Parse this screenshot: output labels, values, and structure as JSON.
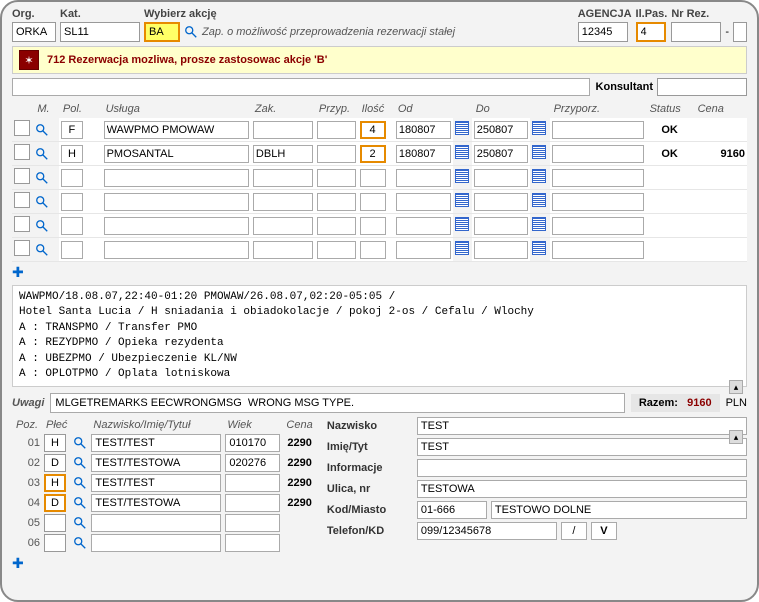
{
  "top": {
    "org_label": "Org.",
    "org": "ORKA",
    "kat_label": "Kat.",
    "kat": "SL11",
    "akcja_label": "Wybierz akcję",
    "akcja": "BA",
    "akcja_desc": "Zap. o możliwość przeprowadzenia rezerwacji stałej",
    "agencja_label": "AGENCJA",
    "agencja": "12345",
    "ilpas_label": "Il.Pas.",
    "ilpas": "4",
    "nrrez_label": "Nr Rez.",
    "nrrez": "",
    "nrrez2": ""
  },
  "message": "712 Rezerwacja mozliwa, prosze zastosowac akcje 'B'",
  "konsultant_label": "Konsultant",
  "grid_headers": {
    "m": "M.",
    "pol": "Pol.",
    "usluga": "Usługa",
    "zak": "Zak.",
    "przyp": "Przyp.",
    "ilosc": "Ilość",
    "od": "Od",
    "do": "Do",
    "przyporz": "Przyporz.",
    "status": "Status",
    "cena": "Cena"
  },
  "rows": [
    {
      "pol": "F",
      "usluga": "WAWPMO PMOWAW",
      "zak": "",
      "ilosc": "4",
      "od": "180807",
      "do": "250807",
      "status": "OK",
      "cena": ""
    },
    {
      "pol": "H",
      "usluga": "PMOSANTAL",
      "zak": "DBLH",
      "ilosc": "2",
      "od": "180807",
      "do": "250807",
      "status": "OK",
      "cena": "9160"
    },
    {
      "pol": "",
      "usluga": "",
      "zak": "",
      "ilosc": "",
      "od": "",
      "do": "",
      "status": "",
      "cena": ""
    },
    {
      "pol": "",
      "usluga": "",
      "zak": "",
      "ilosc": "",
      "od": "",
      "do": "",
      "status": "",
      "cena": ""
    },
    {
      "pol": "",
      "usluga": "",
      "zak": "",
      "ilosc": "",
      "od": "",
      "do": "",
      "status": "",
      "cena": ""
    },
    {
      "pol": "",
      "usluga": "",
      "zak": "",
      "ilosc": "",
      "od": "",
      "do": "",
      "status": "",
      "cena": ""
    }
  ],
  "details_text": "WAWPMO/18.08.07,22:40-01:20 PMOWAW/26.08.07,02:20-05:05 /\nHotel Santa Lucia / H sniadania i obiadokolacje / pokoj 2-os / Cefalu / Wlochy\nA : TRANSPMO / Transfer PMO\nA : REZYDPMO / Opieka rezydenta\nA : UBEZPMO / Ubezpieczenie KL/NW\nA : OPLOTPMO / Oplata lotniskowa",
  "uwagi_label": "Uwagi",
  "uwagi": "MLGETREMARKS EECWRONGMSG  WRONG MSG TYPE.",
  "razem_label": "Razem:",
  "razem_value": "9160",
  "razem_cur": "PLN",
  "pax_headers": {
    "poz": "Poz.",
    "plec": "Płeć",
    "nazwisko": "Nazwisko/Imię/Tytuł",
    "wiek": "Wiek",
    "cena": "Cena"
  },
  "pax": [
    {
      "idx": "01",
      "plec": "H",
      "name": "TEST/TEST",
      "wiek": "010170",
      "cena": "2290"
    },
    {
      "idx": "02",
      "plec": "D",
      "name": "TEST/TESTOWA",
      "wiek": "020276",
      "cena": "2290"
    },
    {
      "idx": "03",
      "plec": "H",
      "name": "TEST/TEST",
      "wiek": "",
      "cena": "2290"
    },
    {
      "idx": "04",
      "plec": "D",
      "name": "TEST/TESTOWA",
      "wiek": "",
      "cena": "2290"
    },
    {
      "idx": "05",
      "plec": "",
      "name": "",
      "wiek": "",
      "cena": ""
    },
    {
      "idx": "06",
      "plec": "",
      "name": "",
      "wiek": "",
      "cena": ""
    }
  ],
  "contact": {
    "nazwisko_label": "Nazwisko",
    "nazwisko": "TEST",
    "imie_label": "Imię/Tyt",
    "imie": "TEST",
    "info_label": "Informacje",
    "info": "",
    "ulica_label": "Ulica, nr",
    "ulica": "TESTOWA",
    "kod_label": "Kod/Miasto",
    "kod": "01-666",
    "miasto": "TESTOWO DOLNE",
    "tel_label": "Telefon/KD",
    "tel": "099/12345678",
    "k1": "/",
    "k2": "V"
  }
}
